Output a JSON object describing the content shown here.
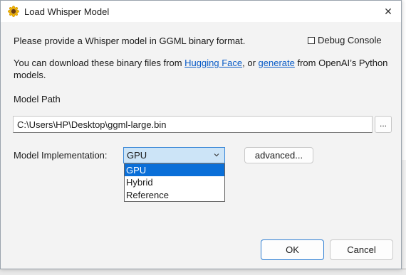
{
  "window": {
    "title": "Load Whisper Model",
    "close_glyph": "✕",
    "app_icon": "sunflower-icon"
  },
  "intro": {
    "line": "Please provide a Whisper model in GGML binary format.",
    "download_prefix": "You can download these binary files from ",
    "link_hugging_face": "Hugging Face",
    "download_middle": ", or ",
    "link_generate": "generate",
    "download_suffix": " from OpenAI’s Python",
    "download_line2": "models."
  },
  "debug_console": {
    "label": "Debug Console",
    "checked": false
  },
  "model_path": {
    "label": "Model Path",
    "value": "C:\\Users\\HP\\Desktop\\ggml-large.bin",
    "browse_label": "..."
  },
  "implementation": {
    "label": "Model Implementation:",
    "selected": "GPU",
    "options": [
      "GPU",
      "Hybrid",
      "Reference"
    ],
    "advanced_label": "advanced..."
  },
  "buttons": {
    "ok": "OK",
    "cancel": "Cancel"
  },
  "colors": {
    "link": "#0a5cc7",
    "selection": "#0a6fd8",
    "select_bg": "#cce4f7",
    "ok_border": "#2f7fd3"
  }
}
